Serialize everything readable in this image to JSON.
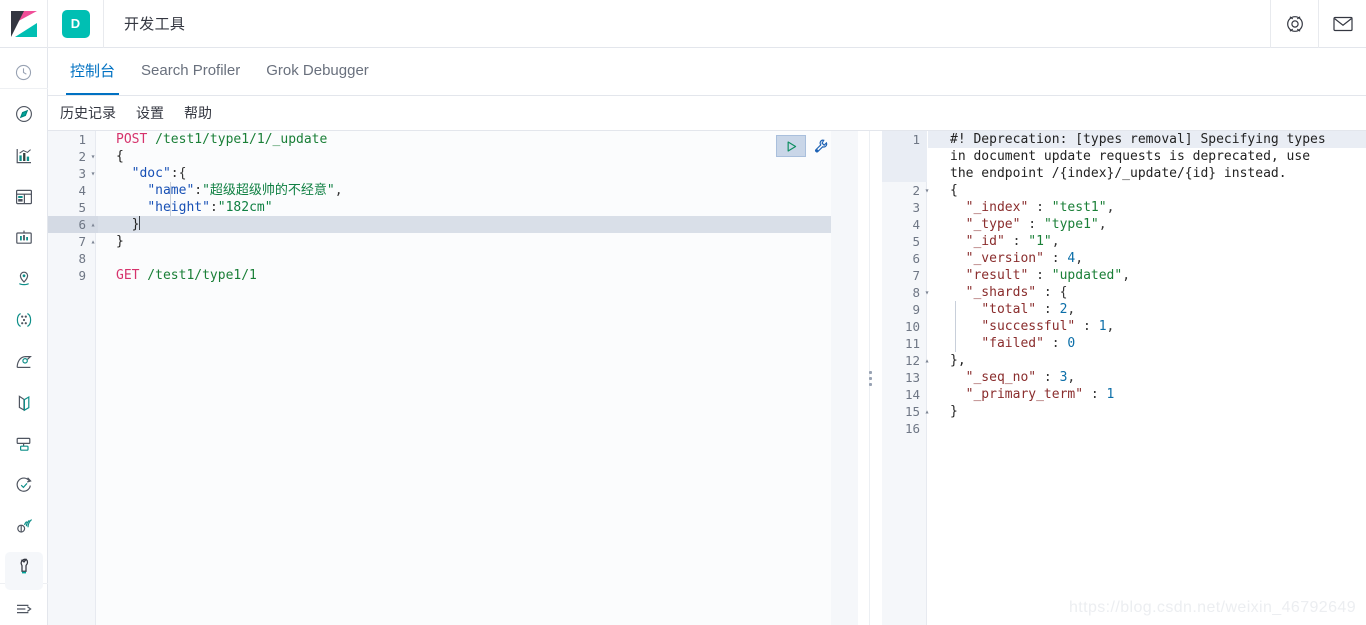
{
  "header": {
    "space_badge": "D",
    "app_title": "开发工具",
    "logo_name": "kibana-logo",
    "help_icon": "help-lifebuoy-icon",
    "mail_icon": "mail-envelope-icon"
  },
  "rail": {
    "items": [
      {
        "name": "recently-viewed",
        "icon": "clock-icon"
      },
      {
        "name": "discover",
        "icon": "compass-icon"
      },
      {
        "name": "visualize",
        "icon": "bar-chart-icon"
      },
      {
        "name": "dashboard",
        "icon": "dashboard-icon"
      },
      {
        "name": "canvas",
        "icon": "canvas-icon"
      },
      {
        "name": "maps",
        "icon": "map-pin-icon"
      },
      {
        "name": "machine-learning",
        "icon": "machine-learning-icon"
      },
      {
        "name": "apm",
        "icon": "apm-icon"
      },
      {
        "name": "logs",
        "icon": "logs-icon"
      },
      {
        "name": "infrastructure",
        "icon": "infrastructure-icon"
      },
      {
        "name": "uptime",
        "icon": "uptime-icon"
      },
      {
        "name": "siem",
        "icon": "siem-icon"
      },
      {
        "name": "dev-tools",
        "icon": "wrench-icon"
      },
      {
        "name": "collapse-nav",
        "icon": "collapse-arrow-icon"
      }
    ]
  },
  "tabs": [
    {
      "label": "控制台",
      "active": true
    },
    {
      "label": "Search Profiler",
      "active": false
    },
    {
      "label": "Grok Debugger",
      "active": false
    }
  ],
  "menu": [
    {
      "label": "历史记录"
    },
    {
      "label": "设置"
    },
    {
      "label": "帮助"
    }
  ],
  "editor": {
    "run_icon": "play-triangle-icon",
    "wrench_icon": "wrench-settings-icon",
    "lines": [
      {
        "n": "1",
        "fold": "",
        "method": "POST",
        "url": " /test1/type1/1/_update"
      },
      {
        "n": "2",
        "fold": "▾",
        "text": "{"
      },
      {
        "n": "3",
        "fold": "▾",
        "key": "\"doc\"",
        "punct": ":{"
      },
      {
        "n": "4",
        "fold": "",
        "key": "\"name\"",
        "punct": ":",
        "value": "\"超级超级帅的不经意\"",
        "tail": ","
      },
      {
        "n": "5",
        "fold": "",
        "key": "\"height\"",
        "punct": ":",
        "value": "\"182cm\"",
        "tail": ""
      },
      {
        "n": "6",
        "fold": "▴",
        "text": "  }",
        "active": true
      },
      {
        "n": "7",
        "fold": "▴",
        "text": "}"
      },
      {
        "n": "8",
        "fold": "",
        "text": ""
      },
      {
        "n": "9",
        "fold": "",
        "method": "GET",
        "url": " /test1/type1/1"
      }
    ]
  },
  "response": {
    "deprecation": "#! Deprecation: [types removal] Specifying types in document update requests is deprecated, use the endpoint /{index}/_update/{id} instead.",
    "lines": [
      {
        "n": "2",
        "fold": "▾",
        "text": "{"
      },
      {
        "n": "3",
        "fold": "",
        "key": "\"_index\"",
        "sep": " : ",
        "str": "\"test1\"",
        "tail": ","
      },
      {
        "n": "4",
        "fold": "",
        "key": "\"_type\"",
        "sep": " : ",
        "str": "\"type1\"",
        "tail": ","
      },
      {
        "n": "5",
        "fold": "",
        "key": "\"_id\"",
        "sep": " : ",
        "str": "\"1\"",
        "tail": ","
      },
      {
        "n": "6",
        "fold": "",
        "key": "\"_version\"",
        "sep": " : ",
        "num": "4",
        "tail": ","
      },
      {
        "n": "7",
        "fold": "",
        "key": "\"result\"",
        "sep": " : ",
        "str": "\"updated\"",
        "tail": ","
      },
      {
        "n": "8",
        "fold": "▾",
        "key": "\"_shards\"",
        "sep": " : ",
        "tail": "{"
      },
      {
        "n": "9",
        "fold": "",
        "indent": 1,
        "key": "\"total\"",
        "sep": " : ",
        "num": "2",
        "tail": ","
      },
      {
        "n": "10",
        "fold": "",
        "indent": 1,
        "key": "\"successful\"",
        "sep": " : ",
        "num": "1",
        "tail": ","
      },
      {
        "n": "11",
        "fold": "",
        "indent": 1,
        "key": "\"failed\"",
        "sep": " : ",
        "num": "0",
        "tail": ""
      },
      {
        "n": "12",
        "fold": "▴",
        "text": "},"
      },
      {
        "n": "13",
        "fold": "",
        "key": "\"_seq_no\"",
        "sep": " : ",
        "num": "3",
        "tail": ","
      },
      {
        "n": "14",
        "fold": "",
        "key": "\"_primary_term\"",
        "sep": " : ",
        "num": "1",
        "tail": ""
      },
      {
        "n": "15",
        "fold": "▴",
        "text": "}"
      },
      {
        "n": "16",
        "fold": "",
        "text": ""
      }
    ]
  },
  "watermark": "https://blog.csdn.net/weixin_46792649",
  "colors": {
    "brand_pink": "#f04e98",
    "brand_teal": "#00bfb3",
    "accent_blue": "#0071c2",
    "deprecation": "#c94f2d"
  }
}
